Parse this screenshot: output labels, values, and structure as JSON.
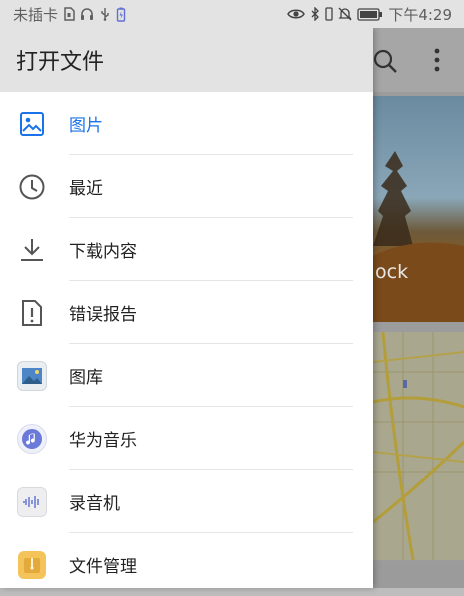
{
  "statusbar": {
    "carrier": "未插卡",
    "time": "下午4:29"
  },
  "drawer": {
    "title": "打开文件",
    "items": [
      {
        "label": "图片",
        "icon": "image-icon",
        "active": true
      },
      {
        "label": "最近",
        "icon": "clock-icon"
      },
      {
        "label": "下载内容",
        "icon": "download-icon"
      },
      {
        "label": "错误报告",
        "icon": "bug-report-icon"
      },
      {
        "label": "图库",
        "icon": "gallery-app-icon"
      },
      {
        "label": "华为音乐",
        "icon": "huawei-music-app-icon"
      },
      {
        "label": "录音机",
        "icon": "recorder-app-icon"
      },
      {
        "label": "文件管理",
        "icon": "file-manager-app-icon"
      }
    ]
  },
  "background": {
    "thumbnail_caption": "ock"
  },
  "colors": {
    "accent": "#1a73e8",
    "header_bg": "#e3e3e3"
  }
}
